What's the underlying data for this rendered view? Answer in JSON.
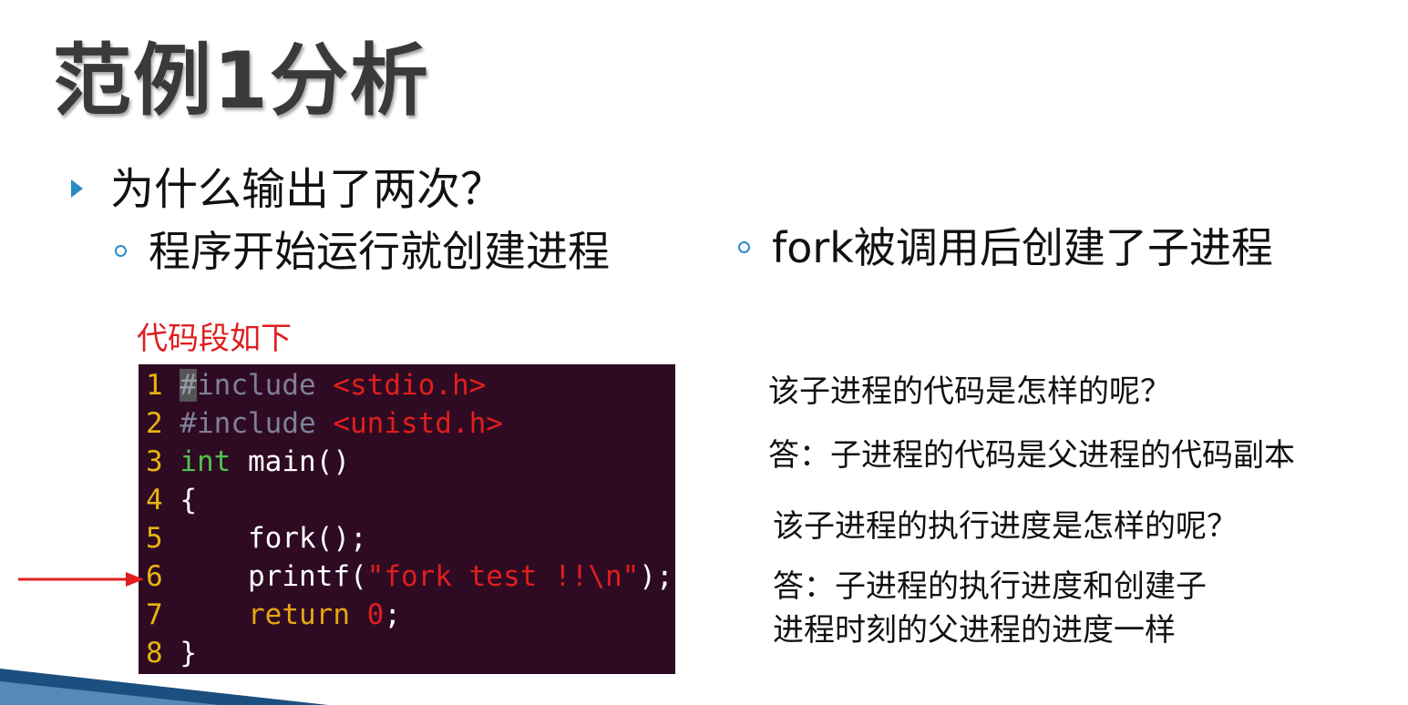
{
  "slide": {
    "title": "范例1分析",
    "bullet": "为什么输出了两次？",
    "sub_left": "程序开始运行就创建进程",
    "sub_right": "fork被调用后创建了子进程",
    "code_label": "代码段如下",
    "qa": [
      "该子进程的代码是怎样的呢？",
      "答：子进程的代码是父进程的代码副本",
      "该子进程的执行进度是怎样的呢？",
      "答：子进程的执行进度和创建子",
      "进程时刻的父进程的进度一样"
    ]
  },
  "code": {
    "lines": [
      {
        "n": "1",
        "parts": [
          {
            "t": "#",
            "c": "cur"
          },
          {
            "t": "include ",
            "c": "pre"
          },
          {
            "t": "<stdio.h>",
            "c": "str"
          }
        ]
      },
      {
        "n": "2",
        "parts": [
          {
            "t": "#include ",
            "c": "pre"
          },
          {
            "t": "<unistd.h>",
            "c": "str"
          }
        ]
      },
      {
        "n": "3",
        "parts": [
          {
            "t": "int",
            "c": "type"
          },
          {
            "t": " main()",
            "c": "plain"
          }
        ]
      },
      {
        "n": "4",
        "parts": [
          {
            "t": "{",
            "c": "plain"
          }
        ]
      },
      {
        "n": "5",
        "parts": [
          {
            "t": "    fork();",
            "c": "plain"
          }
        ]
      },
      {
        "n": "6",
        "parts": [
          {
            "t": "    printf(",
            "c": "plain"
          },
          {
            "t": "\"fork test !!\\n\"",
            "c": "str"
          },
          {
            "t": ");",
            "c": "plain"
          }
        ]
      },
      {
        "n": "7",
        "parts": [
          {
            "t": "    ",
            "c": "plain"
          },
          {
            "t": "return",
            "c": "kw"
          },
          {
            "t": " ",
            "c": "plain"
          },
          {
            "t": "0",
            "c": "str"
          },
          {
            "t": ";",
            "c": "plain"
          }
        ]
      },
      {
        "n": "8",
        "parts": [
          {
            "t": "}",
            "c": "plain"
          }
        ]
      }
    ],
    "highlight_line": "6"
  },
  "colors": {
    "accent": "#2a8bc9",
    "label_red": "#e01e1e",
    "code_bg": "#2e0b22"
  }
}
